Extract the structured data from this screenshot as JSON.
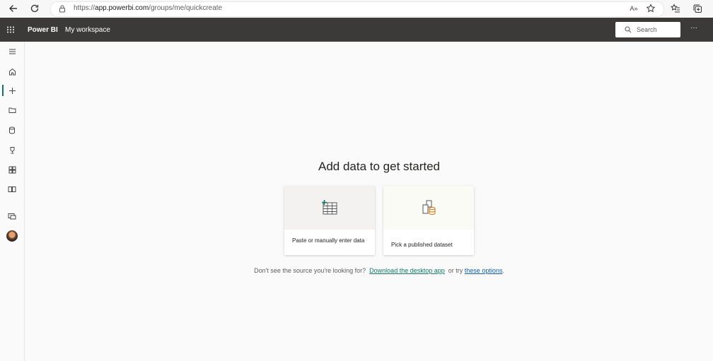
{
  "browser": {
    "url_scheme": "https://",
    "url_host": "app.powerbi.com",
    "url_path": "/groups/me/quickcreate",
    "read_aloud_label": "A»"
  },
  "header": {
    "brand": "Power BI",
    "workspace": "My workspace",
    "search_placeholder": "Search",
    "more_label": "···"
  },
  "nav": {
    "items": [
      {
        "name": "menu",
        "icon": "hamburger-icon"
      },
      {
        "name": "home",
        "icon": "home-icon"
      },
      {
        "name": "create",
        "icon": "plus-icon",
        "active": true
      },
      {
        "name": "browse",
        "icon": "folder-icon"
      },
      {
        "name": "data-hub",
        "icon": "database-icon"
      },
      {
        "name": "goals",
        "icon": "trophy-icon"
      },
      {
        "name": "apps",
        "icon": "apps-icon"
      },
      {
        "name": "learn",
        "icon": "book-icon"
      },
      {
        "name": "workspaces",
        "icon": "workspaces-icon"
      },
      {
        "name": "account",
        "icon": "avatar"
      }
    ]
  },
  "main": {
    "title": "Add data to get started",
    "cards": [
      {
        "label": "Paste or manually enter data",
        "icon": "table-plus-icon"
      },
      {
        "label": "Pick a published dataset",
        "icon": "dataset-icon"
      }
    ],
    "footer": {
      "prefix": "Don't see the source you're looking for?",
      "link1": "Download the desktop app",
      "middle": "or try",
      "link2": "these options",
      "suffix": "."
    }
  },
  "colors": {
    "header_bg": "#3b3a39",
    "accent": "#117865",
    "link": "#0f5ea8"
  }
}
